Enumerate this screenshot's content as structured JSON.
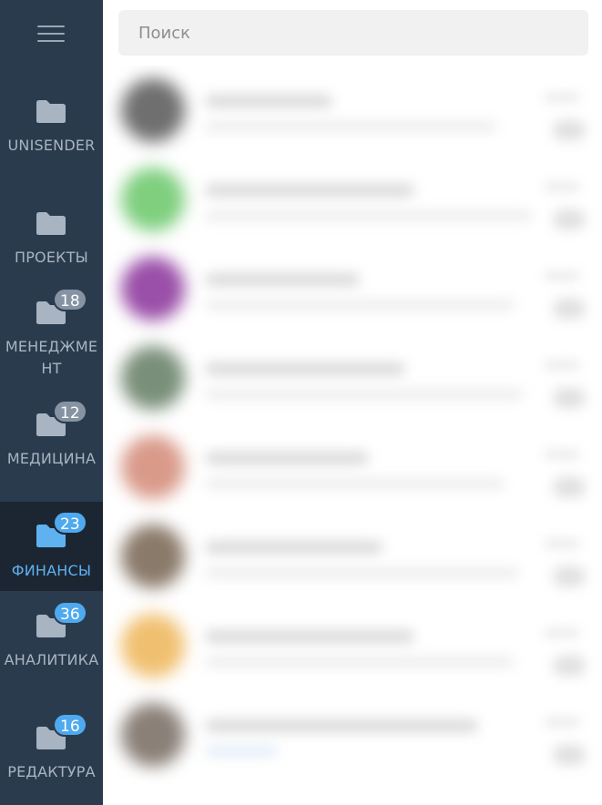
{
  "search": {
    "placeholder": "Поиск"
  },
  "sidebar": {
    "folders": [
      {
        "label": "UNISENDER",
        "badge": ""
      },
      {
        "label": "ПРОЕКТЫ",
        "badge": ""
      },
      {
        "label": "МЕНЕДЖМЕНТ",
        "badge": "18"
      },
      {
        "label": "МЕДИЦИНА",
        "badge": "12"
      },
      {
        "label": "ФИНАНСЫ",
        "badge": "23",
        "active": true
      },
      {
        "label": "АНАЛИТИКА",
        "badge": "36"
      },
      {
        "label": "РЕДАКТУРА",
        "badge": "16"
      }
    ]
  },
  "colors": {
    "sidebar_bg": "#2b3b4e",
    "sidebar_active_bg": "#1c2633",
    "accent": "#4ea9ef",
    "badge_muted": "#8593a3"
  },
  "chat_list": {
    "avatar_colors": [
      "#6f6f6f",
      "#7fcf7f",
      "#9a4fa8",
      "#7a8f7a",
      "#d99a8a",
      "#8a7a6a",
      "#f0c070",
      "#8a8078"
    ]
  }
}
